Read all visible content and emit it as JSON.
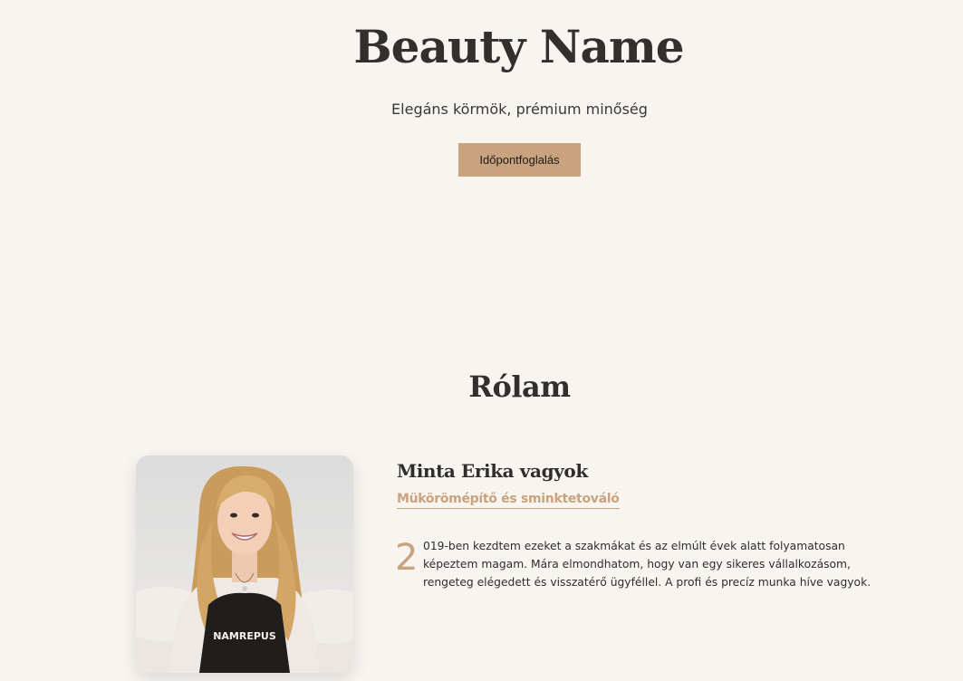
{
  "hero": {
    "title": "Beauty Name",
    "tagline": "Elegáns körmök, prémium minőség",
    "cta_label": "Időpontfoglalás"
  },
  "about": {
    "section_title": "Rólam",
    "name_line": "Minta Erika vagyok",
    "role": "Mükörömépítő és sminktetováló",
    "dropcap": "2",
    "bio": "019-ben kezdtem ezeket a szakmákat és az elmúlt évek alatt folyamatosan képeztem magam. Mára elmondhatom, hogy van egy sikeres vállalkozásom, rengeteg elégedett és visszatérő ügyféllel. A profi és precíz munka híve vagyok.",
    "photo_apron_text": "NAMREPUS"
  },
  "colors": {
    "background": "#f8f5f1",
    "accent": "#c9a27e",
    "text": "#2f2d2b"
  }
}
